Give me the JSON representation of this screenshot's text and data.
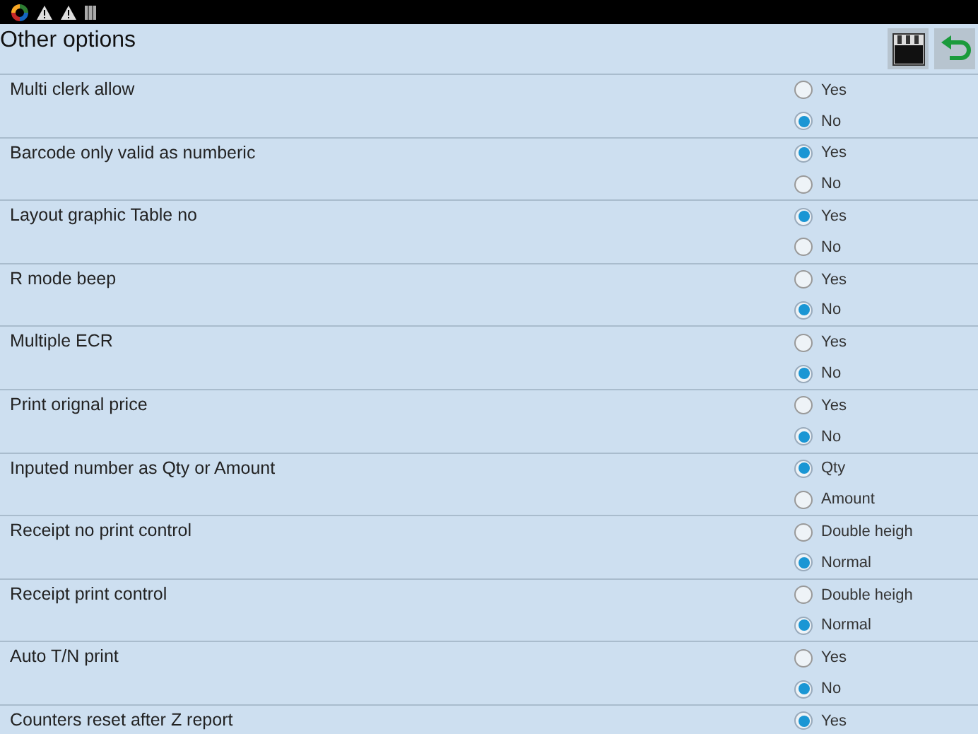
{
  "header": {
    "title": "Other options"
  },
  "settings": [
    {
      "label": "Multi clerk allow",
      "options": [
        {
          "label": "Yes",
          "selected": false
        },
        {
          "label": "No",
          "selected": true
        }
      ]
    },
    {
      "label": "Barcode only valid as numberic",
      "options": [
        {
          "label": "Yes",
          "selected": true
        },
        {
          "label": "No",
          "selected": false
        }
      ]
    },
    {
      "label": "Layout graphic Table no",
      "options": [
        {
          "label": "Yes",
          "selected": true
        },
        {
          "label": "No",
          "selected": false
        }
      ]
    },
    {
      "label": "R mode beep",
      "options": [
        {
          "label": "Yes",
          "selected": false
        },
        {
          "label": "No",
          "selected": true
        }
      ]
    },
    {
      "label": "Multiple ECR",
      "options": [
        {
          "label": "Yes",
          "selected": false
        },
        {
          "label": "No",
          "selected": true
        }
      ]
    },
    {
      "label": "Print orignal price",
      "options": [
        {
          "label": "Yes",
          "selected": false
        },
        {
          "label": "No",
          "selected": true
        }
      ]
    },
    {
      "label": "Inputed number as Qty or Amount",
      "options": [
        {
          "label": "Qty",
          "selected": true
        },
        {
          "label": "Amount",
          "selected": false
        }
      ]
    },
    {
      "label": "Receipt no print control",
      "options": [
        {
          "label": "Double heigh",
          "selected": false
        },
        {
          "label": "Normal",
          "selected": true
        }
      ]
    },
    {
      "label": "Receipt print control",
      "options": [
        {
          "label": "Double heigh",
          "selected": false
        },
        {
          "label": "Normal",
          "selected": true
        }
      ]
    },
    {
      "label": "Auto T/N print",
      "options": [
        {
          "label": "Yes",
          "selected": false
        },
        {
          "label": "No",
          "selected": true
        }
      ]
    },
    {
      "label": "Counters reset after Z report",
      "options": [
        {
          "label": "Yes",
          "selected": true
        }
      ]
    }
  ]
}
